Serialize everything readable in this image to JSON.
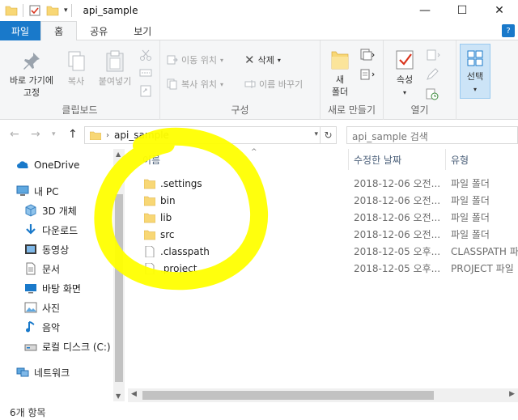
{
  "window": {
    "title": "api_sample",
    "minimize": "—",
    "maximize": "☐",
    "close": "✕"
  },
  "tabs": [
    {
      "label": "파일"
    },
    {
      "label": "홈"
    },
    {
      "label": "공유"
    },
    {
      "label": "보기"
    }
  ],
  "ribbon": {
    "clipboard": {
      "pin_label_1": "바로 가기에",
      "pin_label_2": "고정",
      "copy": "복사",
      "paste": "붙여넣기",
      "group": "클립보드"
    },
    "organize": {
      "move": "이동 위치",
      "copy_to": "복사 위치",
      "delete": "삭제",
      "rename": "이름 바꾸기",
      "group": "구성"
    },
    "new": {
      "new_folder_1": "새",
      "new_folder_2": "폴더",
      "group": "새로 만들기"
    },
    "open": {
      "properties": "속성",
      "group": "열기"
    },
    "select": {
      "label": "선택"
    }
  },
  "address": {
    "path": "api_sample",
    "search_placeholder": "api_sample 검색"
  },
  "nav": [
    {
      "label": "OneDrive",
      "icon": "cloud-icon"
    },
    {
      "label": "내 PC",
      "icon": "computer-icon"
    },
    {
      "label": "3D 개체",
      "icon": "3d-objects-icon"
    },
    {
      "label": "다운로드",
      "icon": "download-icon"
    },
    {
      "label": "동영상",
      "icon": "video-icon"
    },
    {
      "label": "문서",
      "icon": "document-icon"
    },
    {
      "label": "바탕 화면",
      "icon": "desktop-icon"
    },
    {
      "label": "사진",
      "icon": "picture-icon"
    },
    {
      "label": "음악",
      "icon": "music-icon"
    },
    {
      "label": "로컬 디스크 (C:)",
      "icon": "disk-icon"
    },
    {
      "label": "네트워크",
      "icon": "network-icon"
    }
  ],
  "columns": {
    "name": "이름",
    "date": "수정한 날짜",
    "type": "유형"
  },
  "files": [
    {
      "name": ".settings",
      "date": "2018-12-06 오전...",
      "type": "파일 폴더",
      "kind": "folder"
    },
    {
      "name": "bin",
      "date": "2018-12-06 오전...",
      "type": "파일 폴더",
      "kind": "folder"
    },
    {
      "name": "lib",
      "date": "2018-12-06 오전...",
      "type": "파일 폴더",
      "kind": "folder"
    },
    {
      "name": "src",
      "date": "2018-12-06 오전...",
      "type": "파일 폴더",
      "kind": "folder"
    },
    {
      "name": ".classpath",
      "date": "2018-12-05 오후...",
      "type": "CLASSPATH 파일",
      "kind": "file"
    },
    {
      "name": ".project",
      "date": "2018-12-05 오후...",
      "type": "PROJECT 파일",
      "kind": "file"
    }
  ],
  "status": {
    "count": "6개 항목"
  },
  "colors": {
    "accent": "#1979ca",
    "folder": "#f8d775",
    "highlight": "#ffff00"
  }
}
